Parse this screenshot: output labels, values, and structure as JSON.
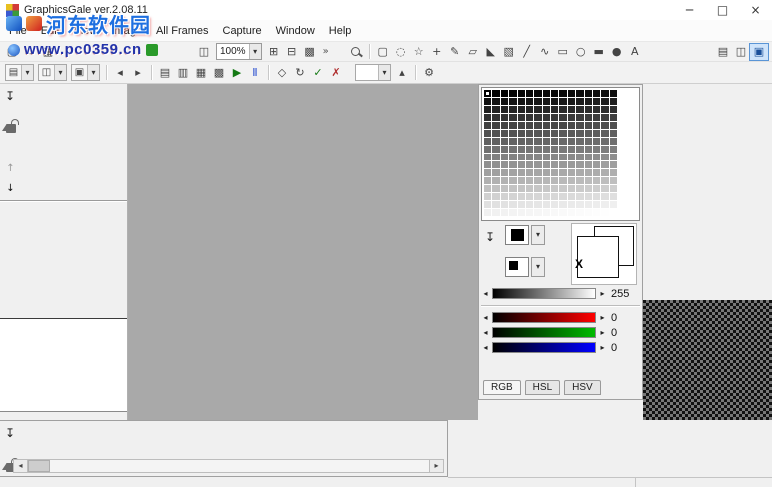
{
  "window": {
    "title": "GraphicsGale ver.2.08.11",
    "controls": [
      {
        "name": "minimize",
        "glyph": "─"
      },
      {
        "name": "maximize",
        "glyph": "□"
      },
      {
        "name": "close",
        "glyph": "×"
      }
    ]
  },
  "watermark": {
    "line1": "河东软件园",
    "line2": "www.pc0359.cn"
  },
  "menu": {
    "items": [
      "File",
      "Edit",
      "View",
      "Image",
      "All Frames",
      "Capture",
      "Window",
      "Help"
    ]
  },
  "colors": {
    "canvas_gray": "#a9a9a9",
    "accent_blue": "#3f74cf",
    "watermark_title_blue": "#1e6fe0",
    "watermark_url_blue": "#2233aa"
  },
  "toolbar_main": {
    "items": [
      {
        "type": "button",
        "name": "new-file",
        "glyph": "▢"
      },
      {
        "type": "button",
        "name": "open-file",
        "glyph": "▭"
      },
      {
        "type": "button",
        "name": "save-file",
        "glyph": "▦"
      },
      {
        "type": "gap",
        "size": 138
      },
      {
        "type": "button",
        "name": "capture-window",
        "glyph": "◫"
      },
      {
        "type": "zoom-combo",
        "name": "zoom-level",
        "value": "100%",
        "arrow": "▾"
      },
      {
        "type": "button",
        "name": "show-grid",
        "glyph": "⊞"
      },
      {
        "type": "button",
        "name": "show-half-grid",
        "glyph": "⊟"
      },
      {
        "type": "button",
        "name": "tile-preview",
        "glyph": "▩"
      },
      {
        "type": "chevron",
        "name": "toolbar-overflow",
        "glyph": "»"
      },
      {
        "type": "gap",
        "size": 14
      },
      {
        "type": "button",
        "name": "zoom-tool",
        "icon": "magnifier"
      },
      {
        "type": "sep"
      },
      {
        "type": "button",
        "name": "select-rectangle-tool",
        "glyph": "▢"
      },
      {
        "type": "button",
        "name": "lasso-tool",
        "glyph": "◌"
      },
      {
        "type": "button",
        "name": "magic-wand-tool",
        "glyph": "☆"
      },
      {
        "type": "button",
        "name": "move-tool",
        "glyph": "+"
      },
      {
        "type": "button",
        "name": "pencil-tool",
        "glyph": "✎"
      },
      {
        "type": "button",
        "name": "eraser-tool",
        "glyph": "▱"
      },
      {
        "type": "button",
        "name": "fill-tool",
        "glyph": "◣"
      },
      {
        "type": "button",
        "name": "gradient-tool",
        "glyph": "▧"
      },
      {
        "type": "button",
        "name": "line-tool",
        "glyph": "╱"
      },
      {
        "type": "button",
        "name": "curve-tool",
        "glyph": "∿"
      },
      {
        "type": "button",
        "name": "rectangle-tool",
        "glyph": "▭"
      },
      {
        "type": "button",
        "name": "ellipse-tool",
        "glyph": "○"
      },
      {
        "type": "button",
        "name": "filled-rectangle-tool",
        "glyph": "▬"
      },
      {
        "type": "button",
        "name": "filled-ellipse-tool",
        "glyph": "●"
      },
      {
        "type": "button",
        "name": "text-tool",
        "glyph": "A"
      },
      {
        "type": "spacer"
      },
      {
        "type": "button",
        "name": "toggle-palette-window",
        "glyph": "▤"
      },
      {
        "type": "button",
        "name": "toggle-preview-window",
        "glyph": "◫"
      },
      {
        "type": "button",
        "name": "toggle-frame-window",
        "glyph": "▣",
        "active": true
      },
      {
        "type": "gap",
        "size": 4
      }
    ]
  },
  "toolbar_frames": {
    "items": [
      {
        "type": "combo",
        "name": "save-format",
        "glyph": "▤",
        "arrow": "▾"
      },
      {
        "type": "combo",
        "name": "copy-frame",
        "glyph": "◫",
        "arrow": "▾"
      },
      {
        "type": "combo",
        "name": "paste-frame",
        "glyph": "▣",
        "arrow": "▾"
      },
      {
        "type": "sep"
      },
      {
        "type": "button",
        "name": "previous-frame",
        "glyph": "◂"
      },
      {
        "type": "button",
        "name": "next-frame",
        "glyph": "▸"
      },
      {
        "type": "sep"
      },
      {
        "type": "button",
        "name": "add-frame",
        "glyph": "▤"
      },
      {
        "type": "button",
        "name": "duplicate-frame",
        "glyph": "▥"
      },
      {
        "type": "button",
        "name": "delete-frame",
        "glyph": "▦"
      },
      {
        "type": "button",
        "name": "frame-properties",
        "glyph": "▩"
      },
      {
        "type": "button",
        "name": "play-animation",
        "glyph": "▶",
        "color": "#157a15"
      },
      {
        "type": "button",
        "name": "pause-animation",
        "glyph": "Ⅱ",
        "color": "#2b4fd0"
      },
      {
        "type": "sep"
      },
      {
        "type": "button",
        "name": "onion-skin",
        "glyph": "◇"
      },
      {
        "type": "button",
        "name": "loop-playback",
        "glyph": "↻"
      },
      {
        "type": "button",
        "name": "apply-changes",
        "glyph": "✓",
        "color": "#157a15"
      },
      {
        "type": "button",
        "name": "cancel-changes",
        "glyph": "✗",
        "color": "#b03030"
      },
      {
        "type": "gap",
        "size": 8
      },
      {
        "type": "combo",
        "name": "transparency-mode",
        "glyph": " ",
        "arrow": "▾",
        "wide": true
      },
      {
        "type": "button",
        "name": "collapse-panel",
        "glyph": "▴"
      },
      {
        "type": "sep"
      },
      {
        "type": "button",
        "name": "settings",
        "glyph": "⚙"
      }
    ]
  },
  "left_panel": {
    "pin_glyph": "↧",
    "move_up_glyph": "↑",
    "move_down_glyph": "↓"
  },
  "color_panel": {
    "pin_glyph": "↧",
    "fg_arrow": "▾",
    "bg_arrow": "▾",
    "transparent_label": "X",
    "palette": {
      "rows": 16,
      "cols": 16,
      "gray_start": 0,
      "gray_end": 255,
      "selected_index": 0
    },
    "sliders": [
      {
        "name": "alpha",
        "value": "255",
        "left_arrow": "◂",
        "right_arrow": "▸"
      },
      {
        "name": "red",
        "value": "0",
        "left_arrow": "◂",
        "right_arrow": "▸"
      },
      {
        "name": "green",
        "value": "0",
        "left_arrow": "◂",
        "right_arrow": "▸"
      },
      {
        "name": "blue",
        "value": "0",
        "left_arrow": "◂",
        "right_arrow": "▸"
      }
    ],
    "tabs": [
      {
        "label": "RGB",
        "active": true
      },
      {
        "label": "HSL",
        "active": false
      },
      {
        "label": "HSV",
        "active": false
      }
    ]
  },
  "bottom_panel": {
    "pin_glyph": "↧",
    "scroll_left": "◂",
    "scroll_right": "▸"
  }
}
